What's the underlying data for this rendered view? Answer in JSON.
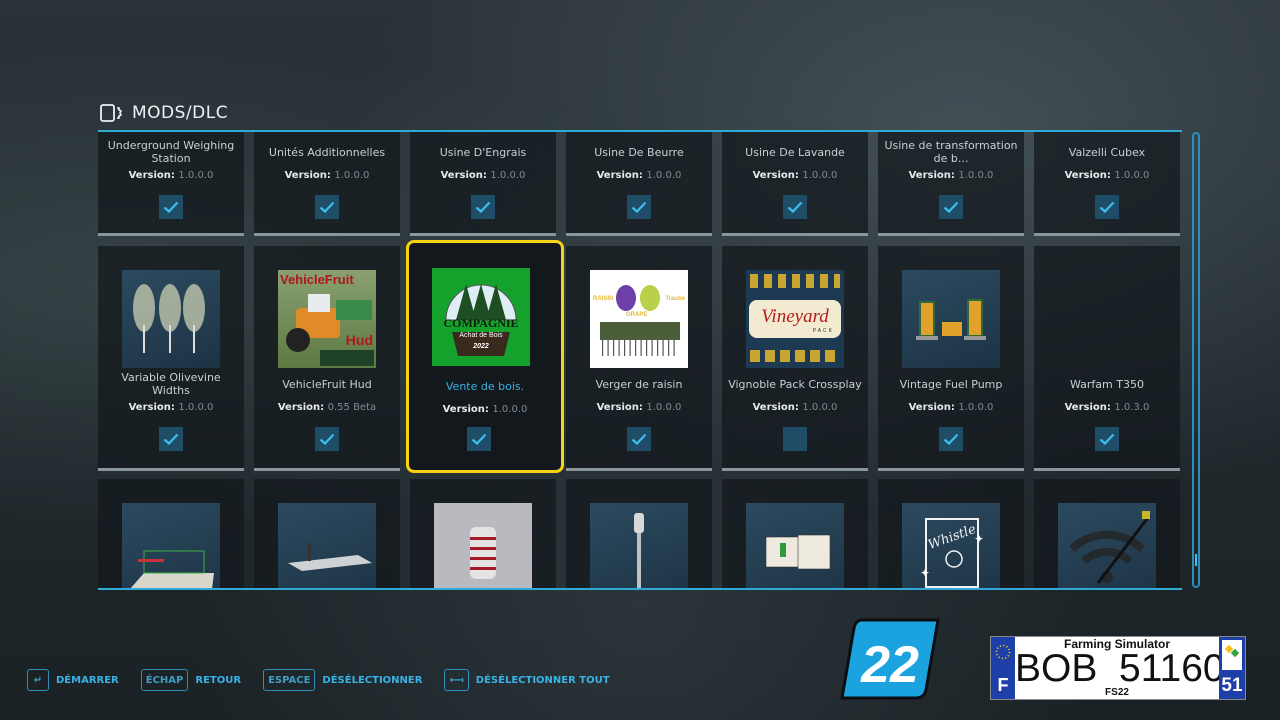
{
  "header": {
    "title": "MODS/DLC",
    "icon": "mods-icon"
  },
  "version_label": "Version:",
  "rows": [
    {
      "tiles": [
        {
          "name": "Underground Weighing Station",
          "version": "1.0.0.0",
          "checked": true,
          "thumb": "none"
        },
        {
          "name": "Unités Additionnelles",
          "version": "1.0.0.0",
          "checked": true,
          "thumb": "none"
        },
        {
          "name": "Usine D'Engrais",
          "version": "1.0.0.0",
          "checked": true,
          "thumb": "none"
        },
        {
          "name": "Usine De Beurre",
          "version": "1.0.0.0",
          "checked": true,
          "thumb": "none"
        },
        {
          "name": "Usine De Lavande",
          "version": "1.0.0.0",
          "checked": true,
          "thumb": "none"
        },
        {
          "name": "Usine de transformation de b...",
          "version": "1.0.0.0",
          "checked": true,
          "thumb": "none"
        },
        {
          "name": "Valzelli Cubex",
          "version": "1.0.0.0",
          "checked": true,
          "thumb": "none"
        }
      ]
    },
    {
      "tiles": [
        {
          "name": "Variable Olivevine Widths",
          "version": "1.0.0.0",
          "checked": true,
          "thumb": "trees-image"
        },
        {
          "name": "VehicleFruit Hud",
          "version": "0.55 Beta",
          "checked": true,
          "thumb": "vehiclefruit-image",
          "thumb_text": [
            "VehicleFruit",
            "Hud"
          ]
        },
        {
          "name": "Vente de bois.",
          "version": "1.0.0.0",
          "checked": true,
          "selected": true,
          "thumb": "compagnie-logo",
          "thumb_text": [
            "COMPAGNIE",
            "Achat de Bois",
            "2022"
          ]
        },
        {
          "name": "Verger de raisin",
          "version": "1.0.0.0",
          "checked": true,
          "thumb": "grapes-image",
          "thumb_text": [
            "RAISIN",
            "GRAPE",
            "Traube"
          ]
        },
        {
          "name": "Vignoble Pack Crossplay",
          "version": "1.0.0.0",
          "checked": false,
          "thumb": "vineyard-image",
          "thumb_text": [
            "Vineyard",
            "PACK"
          ]
        },
        {
          "name": "Vintage Fuel Pump",
          "version": "1.0.0.0",
          "checked": true,
          "thumb": "fuel-pump-image"
        },
        {
          "name": "Warfam T350",
          "version": "1.0.3.0",
          "checked": true,
          "thumb": "empty"
        }
      ]
    },
    {
      "tiles": [
        {
          "thumb": "weighing-station-image"
        },
        {
          "thumb": "platform-image"
        },
        {
          "thumb": "silo-image"
        },
        {
          "thumb": "lamp-post-image"
        },
        {
          "thumb": "ibc-tank-image"
        },
        {
          "thumb": "whistle-image",
          "thumb_text": [
            "Whistle"
          ]
        },
        {
          "thumb": "wifi-tool-image"
        }
      ]
    }
  ],
  "footer": {
    "hints": [
      {
        "key": "↵",
        "key_icon": "enter-key-icon",
        "label": "DÉMARRER"
      },
      {
        "key": "ÉCHAP",
        "label": "RETOUR"
      },
      {
        "key": "ESPACE",
        "label": "DÉSÉLECTIONNER"
      },
      {
        "key": "⟻",
        "key_icon": "backspace-key-icon",
        "label": "DÉSÉLECTIONNER TOUT"
      }
    ]
  },
  "branding": {
    "logo_number": "22",
    "plate": {
      "top": "Farming Simulator",
      "number": "BOB  51160",
      "bottom": "FS22",
      "country": "F",
      "department": "51"
    }
  },
  "colors": {
    "accent": "#2fa9d6",
    "selection": "#f6d313",
    "checkbox": "#1f4c66",
    "check": "#3cc0f0",
    "hint": "#39b2e6"
  }
}
